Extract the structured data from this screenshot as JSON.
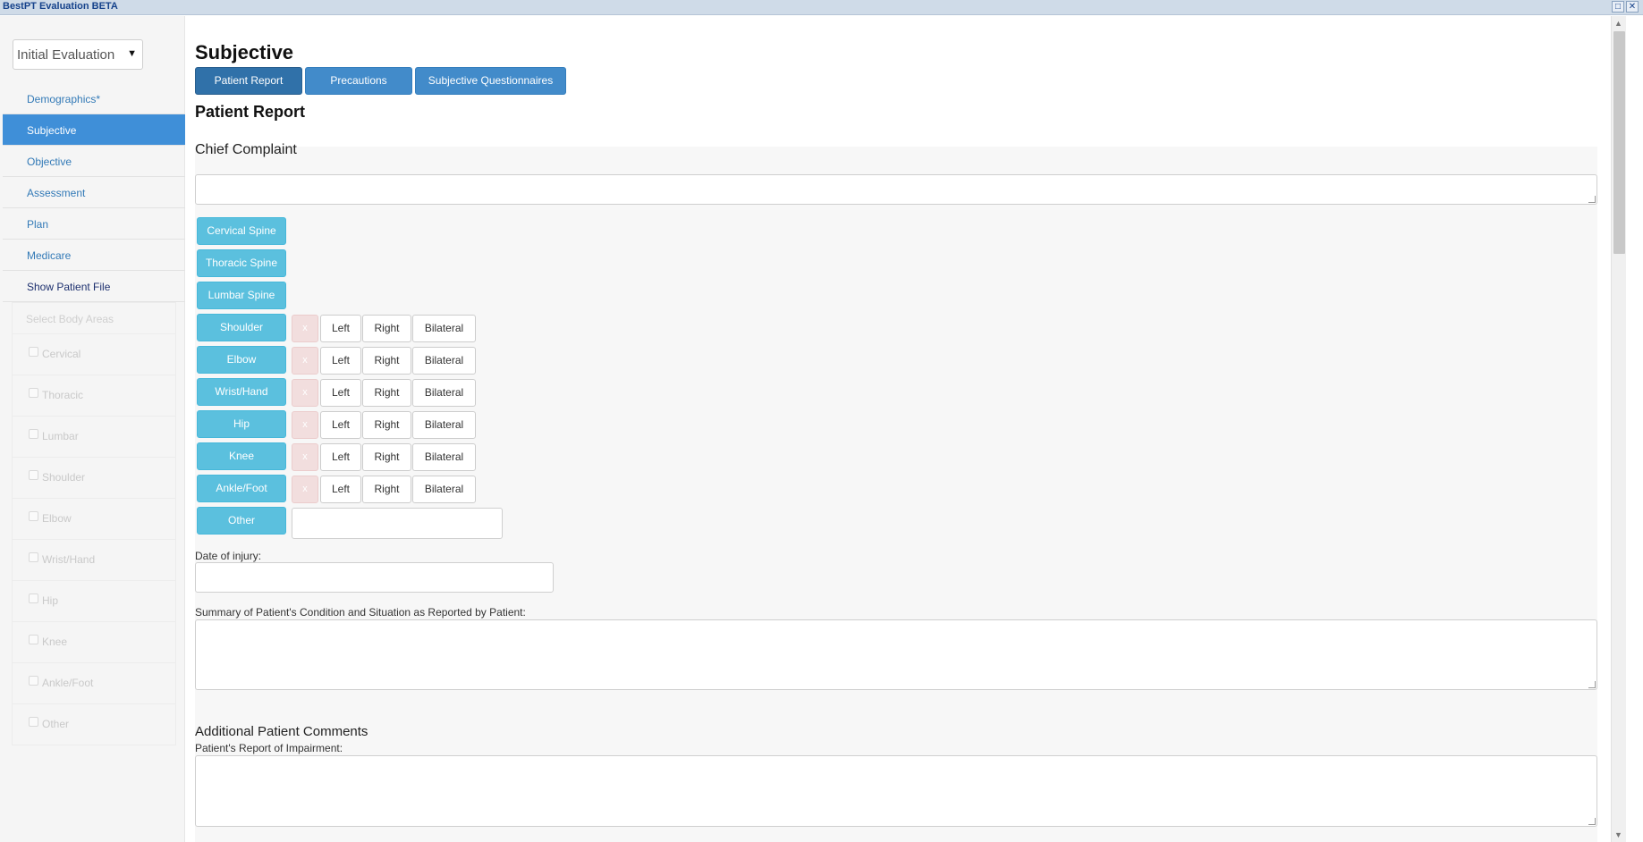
{
  "window": {
    "title": "BestPT Evaluation BETA",
    "restore_icon": "maximize-icon",
    "close_icon": "close-icon"
  },
  "sidebar": {
    "eval_select": "Initial Evaluation",
    "nav": [
      {
        "label": "Demographics*"
      },
      {
        "label": "Subjective"
      },
      {
        "label": "Objective"
      },
      {
        "label": "Assessment"
      },
      {
        "label": "Plan"
      },
      {
        "label": "Medicare"
      },
      {
        "label": "Show Patient File"
      }
    ],
    "body_areas_header": "Select Body Areas",
    "body_areas": [
      "Cervical",
      "Thoracic",
      "Lumbar",
      "Shoulder",
      "Elbow",
      "Wrist/Hand",
      "Hip",
      "Knee",
      "Ankle/Foot",
      "Other"
    ]
  },
  "main": {
    "title": "Subjective",
    "tabs": [
      "Patient Report",
      "Precautions",
      "Subjective Questionnaires"
    ],
    "section_title": "Patient Report",
    "chief_complaint": {
      "heading": "Chief Complaint",
      "value": ""
    },
    "spine_buttons": [
      "Cervical Spine",
      "Thoracic Spine",
      "Lumbar Spine"
    ],
    "joint_rows": [
      {
        "label": "Shoulder"
      },
      {
        "label": "Elbow"
      },
      {
        "label": "Wrist/Hand"
      },
      {
        "label": "Hip"
      },
      {
        "label": "Knee"
      },
      {
        "label": "Ankle/Foot"
      }
    ],
    "side_labels": {
      "x": "x",
      "left": "Left",
      "right": "Right",
      "bilateral": "Bilateral"
    },
    "other_label": "Other",
    "other_value": "",
    "date_of_injury_label": "Date of injury:",
    "date_of_injury_value": "",
    "summary_label": "Summary of Patient's Condition and Situation as Reported by Patient:",
    "summary_value": "",
    "additional_heading": "Additional Patient Comments",
    "impairment_label": "Patient's Report of Impairment:",
    "impairment_value": ""
  },
  "colors": {
    "primary": "#428bca",
    "primary_active": "#3071a9",
    "info": "#5bc0de",
    "danger_light": "#f2dede",
    "nav_active": "#3f8fd8"
  }
}
